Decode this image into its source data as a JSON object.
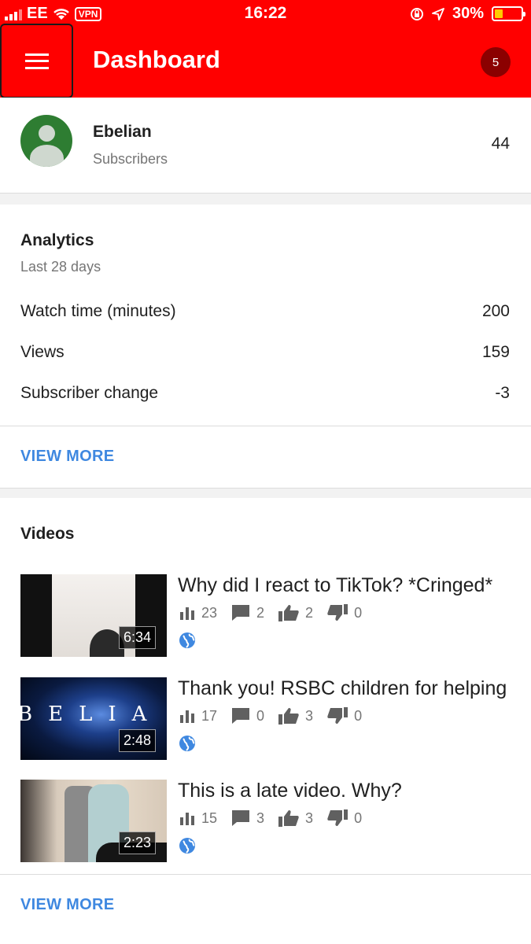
{
  "status_bar": {
    "carrier": "EE",
    "vpn": "VPN",
    "time": "16:22",
    "battery": "30%",
    "battery_level": 0.3
  },
  "app_bar": {
    "title": "Dashboard",
    "notification_count": "5",
    "accent_color": "#ff0000"
  },
  "channel": {
    "name": "Ebelian",
    "subscribers_label": "Subscribers",
    "subscribers_count": "44"
  },
  "analytics": {
    "title": "Analytics",
    "period": "Last 28 days",
    "metrics": [
      {
        "label": "Watch time (minutes)",
        "value": "200"
      },
      {
        "label": "Views",
        "value": "159"
      },
      {
        "label": "Subscriber change",
        "value": "-3"
      }
    ],
    "view_more": "VIEW MORE"
  },
  "videos": {
    "title": "Videos",
    "items": [
      {
        "title": "Why did I react to TikTok? *Cringed*",
        "duration": "6:34",
        "views": "23",
        "comments": "2",
        "likes": "2",
        "dislikes": "0"
      },
      {
        "title": "Thank you! RSBC children for helping",
        "duration": "2:48",
        "views": "17",
        "comments": "0",
        "likes": "3",
        "dislikes": "0",
        "thumb_text": "BELIA"
      },
      {
        "title": "This is a late video. Why?",
        "duration": "2:23",
        "views": "15",
        "comments": "3",
        "likes": "3",
        "dislikes": "0"
      }
    ],
    "view_more": "VIEW MORE"
  }
}
